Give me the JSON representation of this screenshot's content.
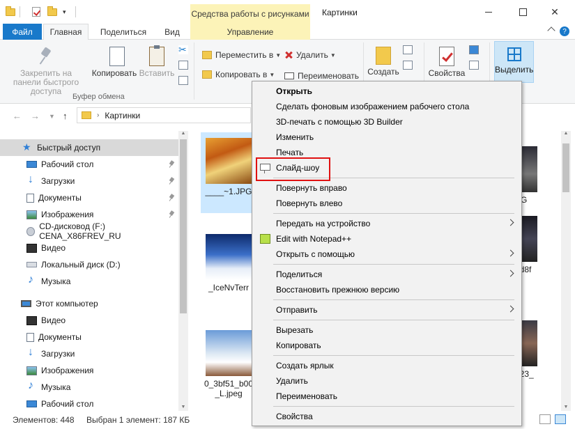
{
  "titlebar": {
    "tools_tab": "Средства работы с рисунками",
    "window_title": "Картинки",
    "close_glyph": "✕"
  },
  "tabs": {
    "file": "Файл",
    "home": "Главная",
    "share": "Поделиться",
    "view": "Вид",
    "manage": "Управление",
    "help": "?"
  },
  "ribbon": {
    "pin": "Закрепить на панели быстрого доступа",
    "copy": "Копировать",
    "paste": "Вставить",
    "clipboard_group": "Буфер обмена",
    "move_to": "Переместить в",
    "copy_to": "Копировать в",
    "delete": "Удалить",
    "rename": "Переименовать",
    "create": "Создать",
    "properties": "Свойства",
    "select": "Выделить"
  },
  "address": {
    "path": "Картинки",
    "back": "←",
    "forward": "→",
    "up": "↑",
    "chev": "›"
  },
  "nav": {
    "items": [
      {
        "label": "Быстрый доступ",
        "icon": "star-icon"
      },
      {
        "label": "Рабочий стол",
        "icon": "desktop-icon"
      },
      {
        "label": "Загрузки",
        "icon": "downloads-icon"
      },
      {
        "label": "Документы",
        "icon": "documents-icon"
      },
      {
        "label": "Изображения",
        "icon": "pictures-icon"
      },
      {
        "label": "CD-дисковод (F:) CENA_X86FREV_RU",
        "icon": "cd-icon"
      },
      {
        "label": "Видео",
        "icon": "video-icon"
      },
      {
        "label": "Локальный диск (D:)",
        "icon": "disk-icon"
      },
      {
        "label": "Музыка",
        "icon": "music-icon"
      },
      {
        "label": "Этот компьютер",
        "icon": "computer-icon"
      },
      {
        "label": "Видео",
        "icon": "video-icon"
      },
      {
        "label": "Документы",
        "icon": "documents-icon"
      },
      {
        "label": "Загрузки",
        "icon": "downloads-icon"
      },
      {
        "label": "Изображения",
        "icon": "pictures-icon"
      },
      {
        "label": "Музыка",
        "icon": "music-icon"
      },
      {
        "label": "Рабочий стол",
        "icon": "desktop-icon"
      }
    ]
  },
  "files": [
    {
      "name": "____~1.JPG"
    },
    {
      "name": "_IceNvTerr"
    },
    {
      "name": "0_3bf51_b00"
    },
    {
      "name": "_L.jpeg"
    },
    {
      "name": "PG"
    },
    {
      "name": "bd8f"
    },
    {
      "name": "923_"
    }
  ],
  "status": {
    "count": "Элементов: 448",
    "selected": "Выбран 1 элемент: 187 КБ"
  },
  "context_menu": {
    "open": "Открыть",
    "set_bg": "Сделать фоновым изображением рабочего стола",
    "print3d": "3D-печать с помощью 3D Builder",
    "edit": "Изменить",
    "print": "Печать",
    "slideshow": "Слайд-шоу",
    "rotate_right": "Повернуть вправо",
    "rotate_left": "Повернуть влево",
    "cast": "Передать на устройство",
    "notepad": "Edit with Notepad++",
    "open_with": "Открыть с помощью",
    "share": "Поделиться",
    "restore": "Восстановить прежнюю версию",
    "send_to": "Отправить",
    "cut": "Вырезать",
    "copy": "Копировать",
    "shortcut": "Создать ярлык",
    "delete": "Удалить",
    "rename": "Переименовать",
    "properties": "Свойства"
  },
  "colors": {
    "accent": "#1979ca",
    "tools_tab": "#fcf3b8",
    "highlight_red": "#e01010",
    "selection": "#cce8ff"
  }
}
